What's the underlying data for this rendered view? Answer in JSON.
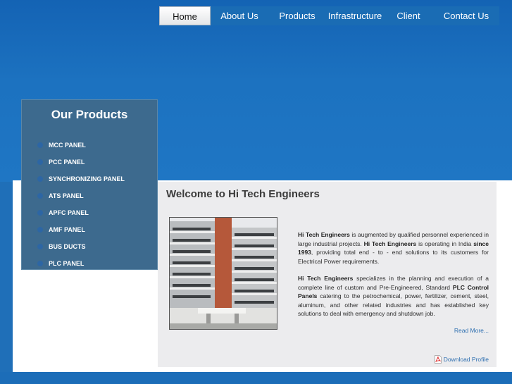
{
  "nav": {
    "items": [
      {
        "label": "Home",
        "active": true
      },
      {
        "label": "About Us"
      },
      {
        "label": "Products"
      },
      {
        "label": "Infrastructure"
      },
      {
        "label": "Client"
      },
      {
        "label": "Contact Us"
      }
    ]
  },
  "sidebar": {
    "title": "Our Products",
    "items": [
      {
        "label": "MCC PANEL"
      },
      {
        "label": "PCC PANEL"
      },
      {
        "label": "SYNCHRONIZING PANEL"
      },
      {
        "label": "ATS PANEL"
      },
      {
        "label": "APFC PANEL"
      },
      {
        "label": "AMF PANEL"
      },
      {
        "label": "BUS DUCTS"
      },
      {
        "label": "PLC PANEL"
      }
    ]
  },
  "main": {
    "title": "Welcome to Hi Tech Engineers",
    "p1": {
      "b1": "Hi Tech Engineers",
      "t1": " is augmented by qualified personnel experienced in large industrial projects. ",
      "b2": "Hi Tech Engineers",
      "t2": " is operating in India ",
      "b3": "since 1993",
      "t3": ", providing total end - to - end solutions to its customers for Electrical Power requirements."
    },
    "p2": {
      "b1": "Hi Tech Engineers",
      "t1": " specializes in the planning and execution of a complete line of custom and Pre-Engineered, Standard ",
      "b2": "PLC Control Panels",
      "t2": " catering to the petrochemical, power, fertilizer, cement, steel, aluminum, and other related industries and has established key solutions to deal with emergency and shutdown job."
    },
    "read_more": "Read More...",
    "download": "Download Profile"
  },
  "colors": {
    "header_blue": "#1f6fb8",
    "sidebar": "#3d6a8e",
    "link": "#2e6fb0"
  }
}
